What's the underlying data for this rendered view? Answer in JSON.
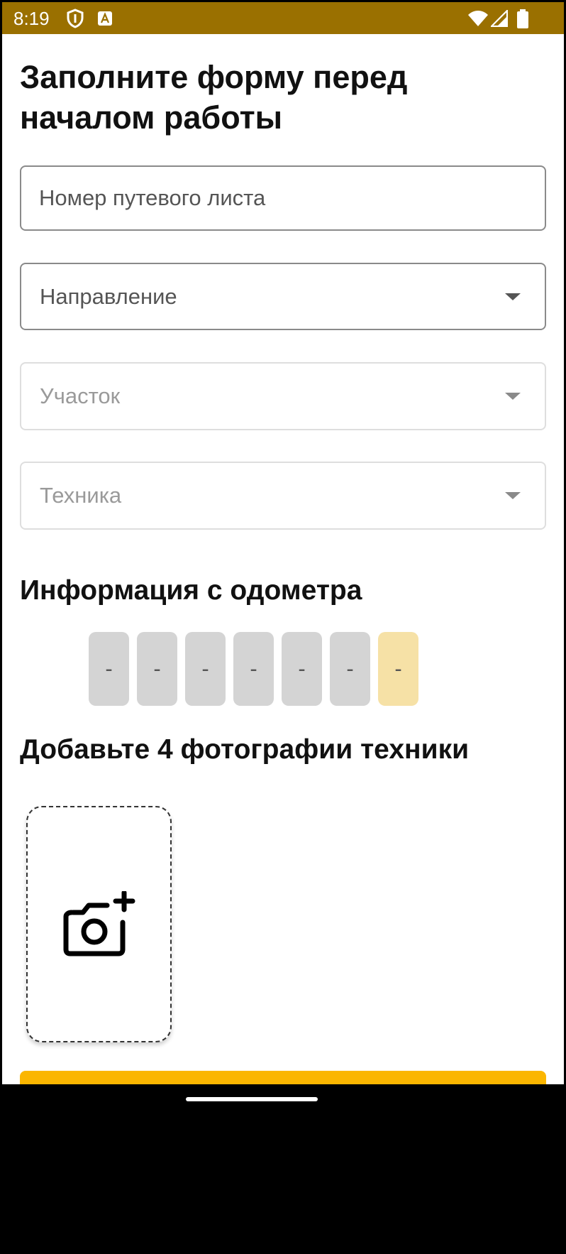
{
  "status_bar": {
    "time": "8:19"
  },
  "form": {
    "title": "Заполните форму перед началом работы",
    "waybill_placeholder": "Номер путевого листа",
    "direction_placeholder": "Направление",
    "section_placeholder": "Участок",
    "equipment_placeholder": "Техника"
  },
  "odometer": {
    "heading": "Информация с одометра",
    "digits": [
      "-",
      "-",
      "-",
      "-",
      "-",
      "-",
      "-"
    ]
  },
  "photos": {
    "heading": "Добавьте 4 фотографии техники"
  },
  "colors": {
    "status_bar": "#9a7000",
    "accent": "#fbb600",
    "odometer_digit": "#d4d4d4",
    "odometer_last_digit": "#f6e1a6"
  },
  "icons": [
    "shield-icon",
    "text-a-icon",
    "wifi-icon",
    "signal-icon",
    "battery-icon",
    "dropdown-caret-icon",
    "camera-add-icon"
  ]
}
